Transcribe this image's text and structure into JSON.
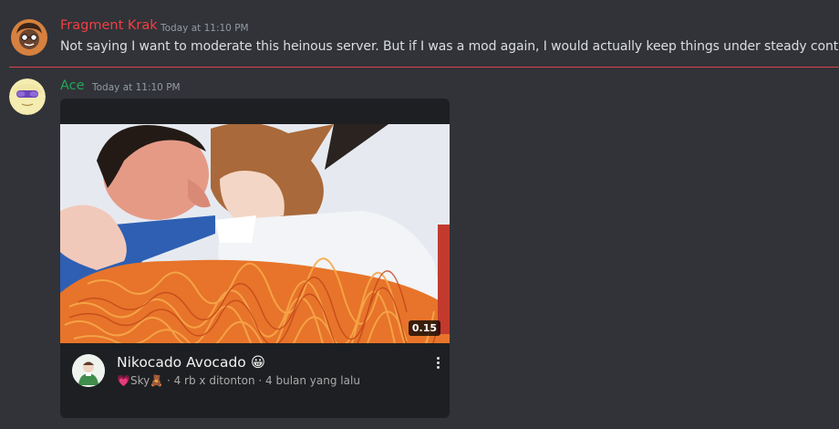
{
  "messages": [
    {
      "author": "Fragment Krak",
      "author_color": "#f23f43",
      "timestamp": "Today at 11:10 PM",
      "text": "Not saying I want to moderate this heinous server. But if I was a mod again, I would actually keep things under steady control.",
      "avatar_icon": "cartoon-face-avatar"
    },
    {
      "author": "Ace",
      "author_color": "#23a55a",
      "timestamp": "Today at 11:10 PM",
      "avatar_icon": "sunglasses-face-avatar",
      "embed": {
        "duration": "0.15",
        "title": "Nikocado Avocado",
        "title_emoji": "😀",
        "channel_prefix": "💗",
        "channel": "Sky",
        "channel_suffix": "🧸",
        "meta": " · 4 rb x ditonton · 4 bulan yang lalu",
        "thumbnail_icon": "video-thumbnail-image",
        "menu_icon": "kebab-menu-icon"
      }
    }
  ],
  "colors": {
    "background": "#313338",
    "divider": "#d9434b",
    "embed_bg": "#1e1f22"
  }
}
